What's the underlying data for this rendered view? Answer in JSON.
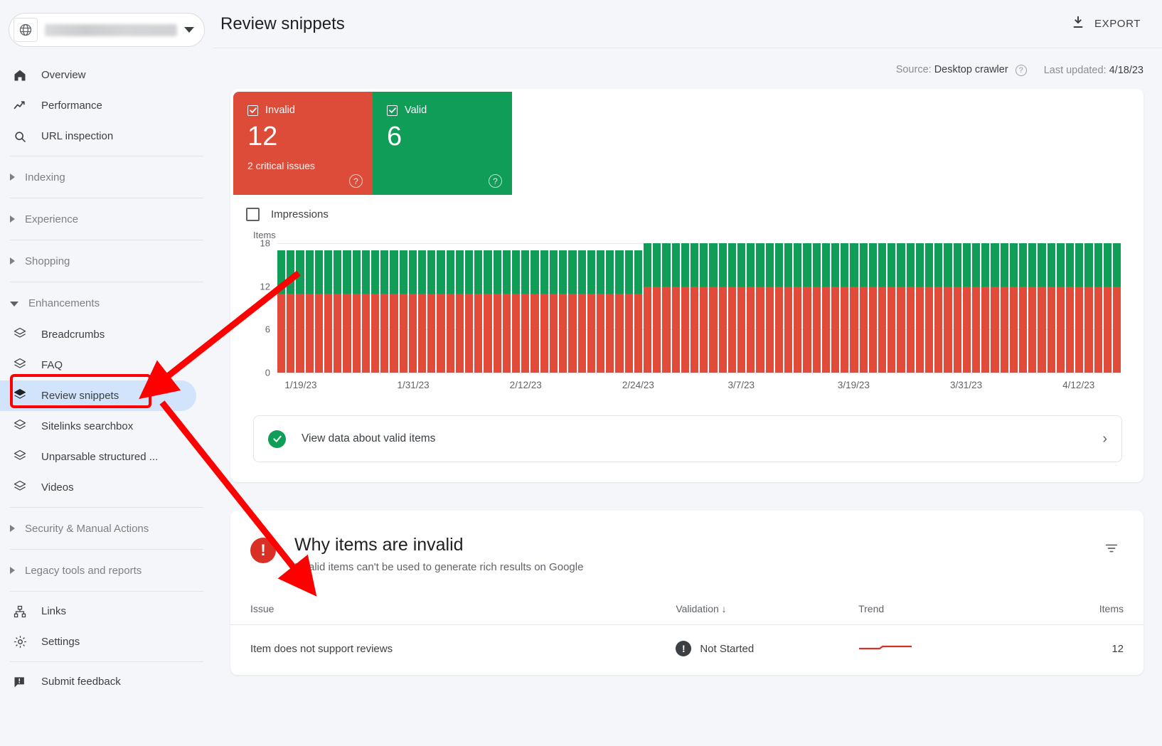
{
  "sidebar": {
    "property": {
      "icon": "globe-icon",
      "name_redacted": true,
      "caret": "chevron-down-icon"
    },
    "items": [
      {
        "label": "Overview",
        "icon": "home-icon"
      },
      {
        "label": "Performance",
        "icon": "trending-up-icon"
      },
      {
        "label": "URL inspection",
        "icon": "search-icon"
      }
    ],
    "groups": [
      {
        "label": "Indexing",
        "expanded": false
      },
      {
        "label": "Experience",
        "expanded": false
      },
      {
        "label": "Shopping",
        "expanded": false
      }
    ],
    "enhancements": {
      "label": "Enhancements",
      "expanded": true,
      "items": [
        {
          "label": "Breadcrumbs",
          "icon": "layers-icon",
          "selected": false
        },
        {
          "label": "FAQ",
          "icon": "layers-icon",
          "selected": false
        },
        {
          "label": "Review snippets",
          "icon": "layers-icon",
          "selected": true
        },
        {
          "label": "Sitelinks searchbox",
          "icon": "layers-icon",
          "selected": false
        },
        {
          "label": "Unparsable structured ...",
          "icon": "layers-icon",
          "selected": false
        },
        {
          "label": "Videos",
          "icon": "layers-icon",
          "selected": false
        }
      ]
    },
    "groups_lower": [
      {
        "label": "Security & Manual Actions",
        "expanded": false
      },
      {
        "label": "Legacy tools and reports",
        "expanded": false
      }
    ],
    "bottom_items": [
      {
        "label": "Links",
        "icon": "sitemap-icon"
      },
      {
        "label": "Settings",
        "icon": "gear-icon"
      }
    ],
    "feedback": {
      "label": "Submit feedback",
      "icon": "feedback-icon"
    }
  },
  "header": {
    "title": "Review snippets",
    "export_label": "EXPORT",
    "export_icon": "download-icon"
  },
  "meta": {
    "source_key": "Source:",
    "source_value": "Desktop crawler",
    "source_help_icon": "help-icon",
    "last_updated_key": "Last updated:",
    "last_updated_value": "4/18/23"
  },
  "status_tiles": [
    {
      "label": "Invalid",
      "count": "12",
      "sub": "2 critical issues",
      "color": "#dd4b39",
      "checked": true,
      "help_icon": "help-icon"
    },
    {
      "label": "Valid",
      "count": "6",
      "sub": "",
      "color": "#0f9d58",
      "checked": true,
      "help_icon": "help-icon"
    }
  ],
  "impressions": {
    "label": "Impressions",
    "checked": false
  },
  "chart_data": {
    "type": "bar",
    "title": "",
    "ylabel": "Items",
    "xlabel": "",
    "ylim": [
      0,
      18
    ],
    "yticks": [
      0,
      6,
      12,
      18
    ],
    "grid": true,
    "legend_position": "top",
    "stacked": true,
    "x_tick_labels": [
      "1/19/23",
      "1/31/23",
      "2/12/23",
      "2/24/23",
      "3/7/23",
      "3/19/23",
      "3/31/23",
      "4/12/23"
    ],
    "x_tick_indices": [
      2,
      14,
      26,
      38,
      49,
      61,
      73,
      85
    ],
    "series": [
      {
        "name": "Invalid",
        "color": "#e04b3a",
        "values": [
          11,
          11,
          11,
          11,
          11,
          11,
          11,
          11,
          11,
          11,
          11,
          11,
          11,
          11,
          11,
          11,
          11,
          11,
          11,
          11,
          11,
          11,
          11,
          11,
          11,
          11,
          11,
          11,
          11,
          11,
          11,
          11,
          11,
          11,
          11,
          11,
          11,
          11,
          11,
          12,
          12,
          12,
          12,
          12,
          12,
          12,
          12,
          12,
          12,
          12,
          12,
          12,
          12,
          12,
          12,
          12,
          12,
          12,
          12,
          12,
          12,
          12,
          12,
          12,
          12,
          12,
          12,
          12,
          12,
          12,
          12,
          12,
          12,
          12,
          12,
          12,
          12,
          12,
          12,
          12,
          12,
          12,
          12,
          12,
          12,
          12,
          12,
          12,
          12,
          12
        ]
      },
      {
        "name": "Valid",
        "color": "#0f9d58",
        "values": [
          6,
          6,
          6,
          6,
          6,
          6,
          6,
          6,
          6,
          6,
          6,
          6,
          6,
          6,
          6,
          6,
          6,
          6,
          6,
          6,
          6,
          6,
          6,
          6,
          6,
          6,
          6,
          6,
          6,
          6,
          6,
          6,
          6,
          6,
          6,
          6,
          6,
          6,
          6,
          6,
          6,
          6,
          6,
          6,
          6,
          6,
          6,
          6,
          6,
          6,
          6,
          6,
          6,
          6,
          6,
          6,
          6,
          6,
          6,
          6,
          6,
          6,
          6,
          6,
          6,
          6,
          6,
          6,
          6,
          6,
          6,
          6,
          6,
          6,
          6,
          6,
          6,
          6,
          6,
          6,
          6,
          6,
          6,
          6,
          6,
          6,
          6,
          6,
          6,
          6
        ]
      }
    ]
  },
  "valid_items_row": {
    "label": "View data about valid items",
    "icon": "check-circle-icon",
    "chevron": "chevron-right-icon"
  },
  "why_invalid": {
    "icon": "error-icon",
    "title": "Why items are invalid",
    "subtitle": "Invalid items can't be used to generate rich results on Google",
    "filter_icon": "filter-icon",
    "columns": [
      "Issue",
      "Validation",
      "Trend",
      "Items"
    ],
    "sorted_column": "Validation",
    "sort_direction": "desc",
    "rows": [
      {
        "issue": "Item does not support reviews",
        "validation": "Not Started",
        "validation_icon": "exclamation-icon",
        "trend": "flat",
        "items": "12"
      }
    ]
  },
  "annotations": {
    "color": "#ff0000",
    "highlight_box": "review-snippets-nav-item",
    "arrows": 2
  }
}
